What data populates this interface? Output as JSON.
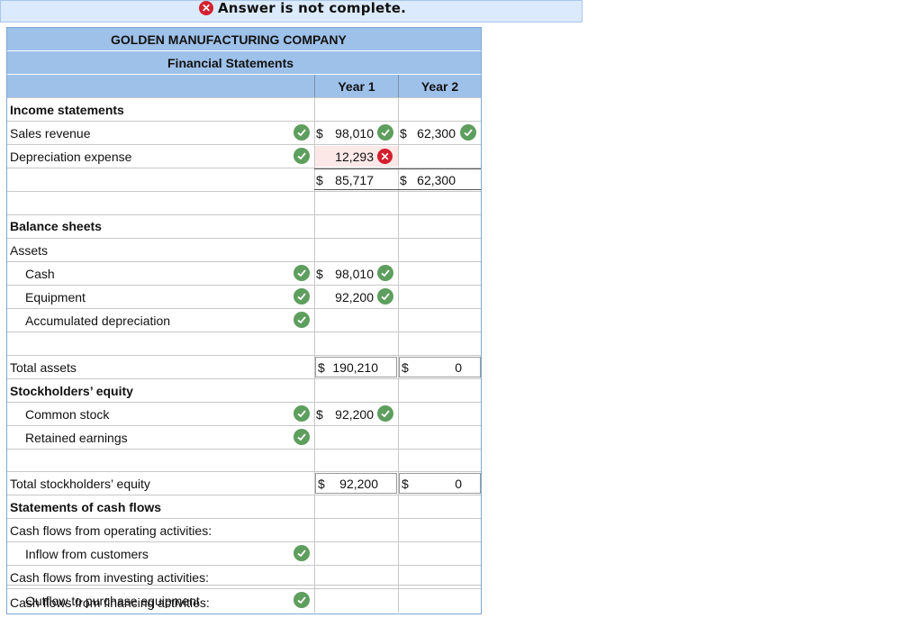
{
  "banner": {
    "text": "Answer is not complete.",
    "icon": "x-circle-icon"
  },
  "header": {
    "company": "GOLDEN MANUFACTURING COMPANY",
    "subtitle": "Financial Statements",
    "year1": "Year 1",
    "year2": "Year 2"
  },
  "rows": {
    "income_title": "Income statements",
    "sales_revenue": {
      "label": "Sales revenue",
      "y1_sign": "$",
      "y1": "98,010",
      "y2_sign": "$",
      "y2": "62,300"
    },
    "depreciation": {
      "label": "Depreciation expense",
      "y1": "12,293"
    },
    "net_income": {
      "y1_sign": "$",
      "y1": "85,717",
      "y2_sign": "$",
      "y2": "62,300"
    },
    "balance_title": "Balance sheets",
    "assets": "Assets",
    "cash": {
      "label": "Cash",
      "y1_sign": "$",
      "y1": "98,010"
    },
    "equipment": {
      "label": "Equipment",
      "y1": "92,200"
    },
    "accum_dep": {
      "label": "Accumulated depreciation"
    },
    "total_assets": {
      "label": "Total assets",
      "y1_sign": "$",
      "y1": "190,210",
      "y2_sign": "$",
      "y2": "0"
    },
    "se_title": "Stockholders’ equity",
    "common_stock": {
      "label": "Common stock",
      "y1_sign": "$",
      "y1": "92,200"
    },
    "retained_earnings": {
      "label": "Retained earnings"
    },
    "total_se": {
      "label": "Total stockholders’ equity",
      "y1_sign": "$",
      "y1": "92,200",
      "y2_sign": "$",
      "y2": "0"
    },
    "cf_title": "Statements of cash flows",
    "cf_operating": "Cash flows from operating activities:",
    "inflow_customers": "Inflow from customers",
    "cf_investing": "Cash flows from investing activities:",
    "outflow_equipment": "Outflow to purchase equipment",
    "cf_financing": "Cash flows from financing activities:"
  },
  "colors": {
    "header_bg": "#9ec1ea",
    "banner_bg": "#dbeafc",
    "check_green": "#5e9e5e",
    "error_red": "#d3202e",
    "error_cell": "#fde8e8"
  }
}
